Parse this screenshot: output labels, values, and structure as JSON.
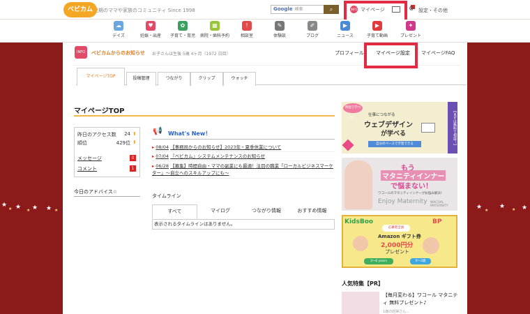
{
  "header": {
    "tagline": "妊娠・育児期のママや家族のコミュニティ Since 1998",
    "search_brand": "Google",
    "search_placeholder": "検索",
    "search_button_icon": "search-icon",
    "mypage_label": "マイページ",
    "mypage_icon_text": "INFO",
    "mail_count": "1",
    "settings_label": "設定・その他"
  },
  "nav": {
    "logo": "べビカム",
    "items": [
      {
        "label": "デイズ",
        "color": "#6aa6e0",
        "icon": "☁"
      },
      {
        "label": "妊娠・出産",
        "color": "#e24a6a",
        "icon": "♥"
      },
      {
        "label": "子育て・育児",
        "color": "#3aa060",
        "icon": "✿"
      },
      {
        "label": "病院・歯科予約",
        "color": "#9ac43a",
        "icon": "▦"
      },
      {
        "label": "相談室",
        "color": "#e24a4a",
        "icon": "!"
      },
      {
        "label": "体験談",
        "color": "#777777",
        "icon": "✎"
      },
      {
        "label": "ブログ",
        "color": "#888888",
        "icon": "✐"
      },
      {
        "label": "ニュース",
        "color": "#4a8ad6",
        "icon": "▶"
      },
      {
        "label": "子育て動画",
        "color": "#e23a3a",
        "icon": "▶"
      },
      {
        "label": "プレゼント",
        "color": "#d03a8a",
        "icon": "✦"
      }
    ]
  },
  "info_bar": {
    "icon_text": "INFO",
    "title": "べビカムからのお知らせ",
    "note": "お子さんは生後 5歳 4ヶ月（1972 日目）",
    "profile": "プロフィール",
    "mypage_settings": "マイページ設定",
    "faq": "マイページFAQ"
  },
  "tabs": [
    "マイページTOP",
    "投稿管理",
    "つながり",
    "クリップ",
    "ウォッチ"
  ],
  "page_title": "マイページTOP",
  "stats": {
    "access_label": "昨日のアクセス数",
    "access_value": "24",
    "rank_label": "順位",
    "rank_value": "429位",
    "message_label": "メッセージ",
    "message_count": "0",
    "comment_label": "コメント",
    "comment_count": "1"
  },
  "advice_title": "今日のアドバイス☆",
  "news": {
    "heading": "What's New！",
    "items": [
      {
        "date": "08/04",
        "text": "【事務局からのお知らせ】2023年・夏季休業について"
      },
      {
        "date": "07/04",
        "text": "『べビカム』システムメンテナンスのお知らせ"
      },
      {
        "date": "06/28",
        "text": "【募集】時間自由・ママの副業にも最適！注目の職業「ローカルビジネスマーケター」～自立へのスキルアップにも～"
      }
    ]
  },
  "timeline": {
    "heading": "タイムライン",
    "tabs": [
      "すべて",
      "マイログ",
      "つながり情報",
      "おすすめ情報"
    ],
    "empty": "表示されるタイムラインはありません。"
  },
  "banners": {
    "b1": {
      "badge": "時短で学べる！",
      "sub": "仕事につながる",
      "big": "ウェブデザイン",
      "big2": "が学べる",
      "bar": "自分のペースで学習できる",
      "side": "【まずは無料で相談！】"
    },
    "b2": {
      "l1": "もう",
      "l2": "マタニティインナー",
      "l3": "で悩まない！",
      "l4": "ワコールのマタニティインナーがお悩み解決！",
      "l5": "Enjoy Maternity",
      "l6": "WACOAL MATERNITY"
    },
    "b3": {
      "kids": "KidsBoo",
      "bp": "BP",
      "badge": "応募者全員",
      "a1": "Amazon ギフト券",
      "a2": "2,000円分",
      "a3": "プレゼント",
      "age1": "3〜6 years",
      "age2": "0〜3歳"
    }
  },
  "popular": {
    "heading": "人気特集【PR】",
    "title": "【毎月変わる】ワコール マタニティ 無料プレゼント♪",
    "sub": "1歳の妊婦さん..."
  }
}
